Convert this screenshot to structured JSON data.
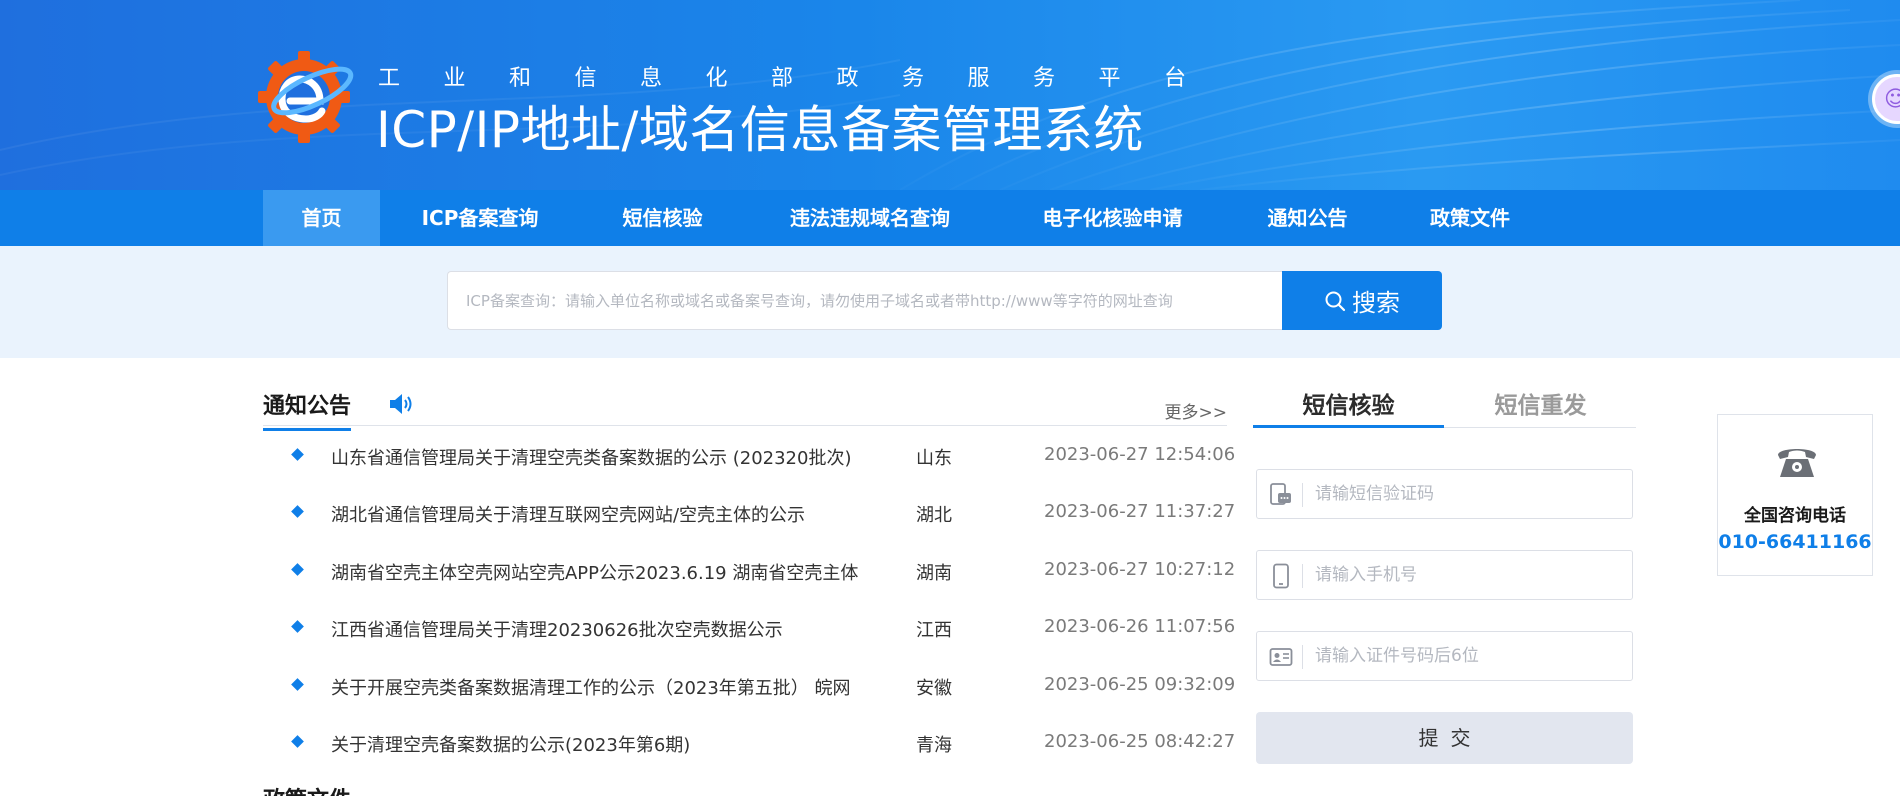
{
  "header": {
    "subtitle": "工业和信息化部政务服务平台",
    "title": "ICP/IP地址/域名信息备案管理系统",
    "logo_icon": "gear-e-logo-icon",
    "edge_widget_icon": "assistant-widget-icon"
  },
  "nav": {
    "items": [
      {
        "label": "首页",
        "active": true
      },
      {
        "label": "ICP备案查询"
      },
      {
        "label": "短信核验"
      },
      {
        "label": "违法违规域名查询"
      },
      {
        "label": "电子化核验申请"
      },
      {
        "label": "通知公告"
      },
      {
        "label": "政策文件"
      }
    ]
  },
  "search": {
    "placeholder": "ICP备案查询：请输入单位名称或域名或备案号查询，请勿使用子域名或者带http://www等字符的网址查询",
    "button_label": "搜索",
    "button_icon": "search-icon"
  },
  "notices": {
    "title": "通知公告",
    "more_label": "更多>>",
    "speaker_icon": "speaker-icon",
    "items": [
      {
        "title": "山东省通信管理局关于清理空壳类备案数据的公示 (202320批次)",
        "province": "山东",
        "time": "2023-06-27 12:54:06"
      },
      {
        "title": "湖北省通信管理局关于清理互联网空壳网站/空壳主体的公示",
        "province": "湖北",
        "time": "2023-06-27 11:37:27"
      },
      {
        "title": "湖南省空壳主体空壳网站空壳APP公示2023.6.19 湖南省空壳主体",
        "province": "湖南",
        "time": "2023-06-27 10:27:12"
      },
      {
        "title": "江西省通信管理局关于清理20230626批次空壳数据公示",
        "province": "江西",
        "time": "2023-06-26 11:07:56"
      },
      {
        "title": "关于开展空壳类备案数据清理工作的公示（2023年第五批） 皖网",
        "province": "安徽",
        "time": "2023-06-25 09:32:09"
      },
      {
        "title": "关于清理空壳备案数据的公示(2023年第6期)",
        "province": "青海",
        "time": "2023-06-25 08:42:27"
      }
    ],
    "next_section_title": "政策文件"
  },
  "sms": {
    "tabs": [
      {
        "label": "短信核验",
        "active": true
      },
      {
        "label": "短信重发"
      }
    ],
    "fields": [
      {
        "placeholder": "请输短信验证码",
        "icon": "sms-code-icon"
      },
      {
        "placeholder": "请输入手机号",
        "icon": "mobile-phone-icon"
      },
      {
        "placeholder": "请输入证件号码后6位",
        "icon": "id-card-icon"
      }
    ],
    "submit_label": "提交"
  },
  "hotline": {
    "label": "全国咨询电话",
    "number": "010-66411166",
    "icon": "telephone-icon"
  },
  "colors": {
    "primary": "#0f7fe8",
    "nav_active": "#3a9af0",
    "search_bg": "#eaf3fd"
  }
}
